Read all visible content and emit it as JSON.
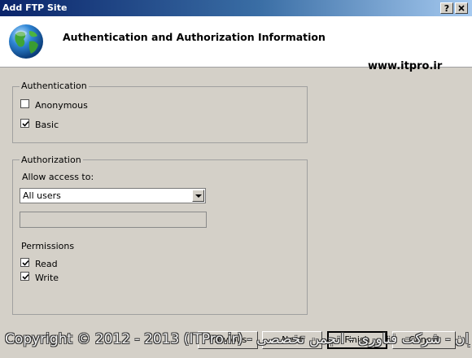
{
  "window": {
    "title": "Add FTP Site",
    "help_label": "?",
    "close_label": "X"
  },
  "header": {
    "title": "Authentication and Authorization Information",
    "watermark": "www.itpro.ir",
    "icon": "globe-icon"
  },
  "authentication": {
    "legend": "Authentication",
    "anonymous": {
      "label": "Anonymous",
      "checked": false
    },
    "basic": {
      "label": "Basic",
      "checked": true
    }
  },
  "authorization": {
    "legend": "Authorization",
    "allow_label": "Allow access to:",
    "allow_value": "All users",
    "user_input_value": "",
    "permissions_label": "Permissions",
    "read": {
      "label": "Read",
      "checked": true
    },
    "write": {
      "label": "Write",
      "checked": true
    }
  },
  "buttons": {
    "previous": "Previous",
    "next": "Next",
    "finish": "Finish",
    "cancel": "Cancel"
  },
  "overlay": {
    "copyright": "Copyright © 2012 - 2013 (ITPro.ir) - اطلاعات ایران - شرکت فناوری - انجمن تخصصی"
  }
}
